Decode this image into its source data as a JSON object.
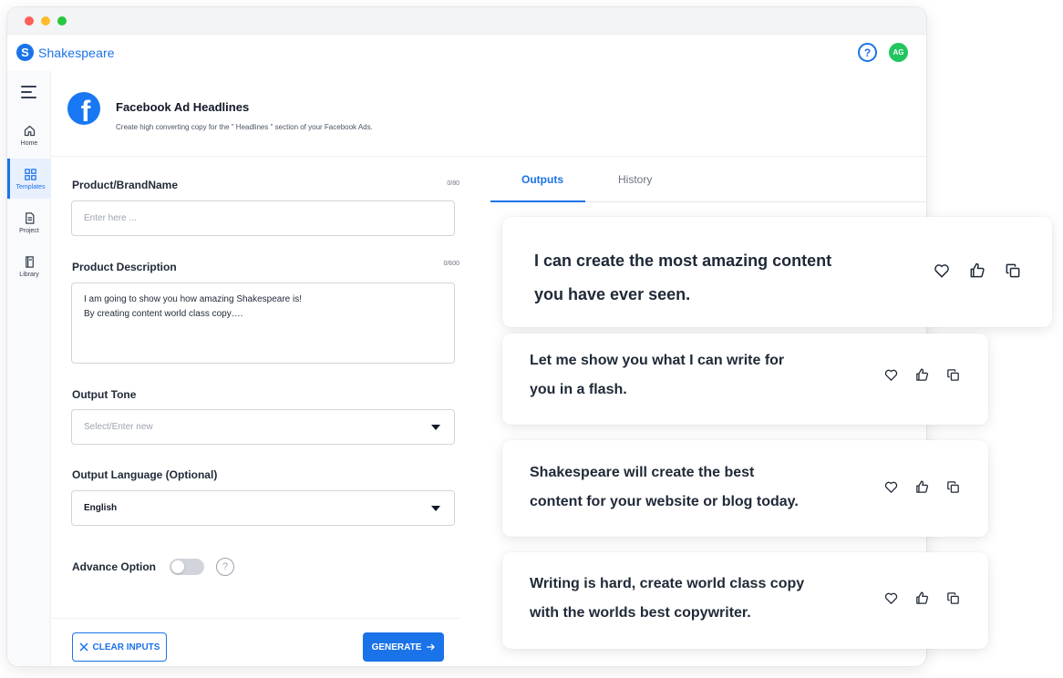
{
  "app": {
    "name": "Shakespeare",
    "logo_letter": "S",
    "help_label": "?",
    "avatar_initials": "AG"
  },
  "sidebar": {
    "items": [
      {
        "label": "Home",
        "icon": "home-icon"
      },
      {
        "label": "Templates",
        "icon": "grid-icon",
        "active": true
      },
      {
        "label": "Project",
        "icon": "document-icon"
      },
      {
        "label": "Library",
        "icon": "book-icon"
      }
    ]
  },
  "header": {
    "icon_letter": "f",
    "title": "Facebook Ad Headlines",
    "subtitle": "Create high converting copy for the \" Headlines \" section of your Facebook Ads."
  },
  "form": {
    "product_name": {
      "label": "Product/BrandName",
      "counter": "0/80",
      "placeholder": "Enter here ...",
      "value": ""
    },
    "product_description": {
      "label": "Product Description",
      "counter": "0/600",
      "value": "I am going to show you how amazing Shakespeare is!\nBy creating content world class copy…."
    },
    "output_tone": {
      "label": "Output Tone",
      "placeholder": "Select/Enter new"
    },
    "output_language": {
      "label": "Output  Language (Optional)",
      "value": "English"
    },
    "advance_option": {
      "label": "Advance Option",
      "enabled": false,
      "help_label": "?"
    },
    "clear_button": "CLEAR INPUTS",
    "generate_button": "GENERATE"
  },
  "output_panel": {
    "tabs": [
      {
        "label": "Outputs",
        "active": true
      },
      {
        "label": "History",
        "active": false
      }
    ],
    "results": [
      {
        "line1": "I can create the most amazing content",
        "line2": "you have ever seen."
      },
      {
        "line1": "Let me show you what I can write for",
        "line2": "you in a flash."
      },
      {
        "line1": "Shakespeare will create the best",
        "line2": "content for your website or blog today."
      },
      {
        "line1": "Writing is hard, create world class copy",
        "line2": "with the worlds best copywriter."
      }
    ]
  },
  "colors": {
    "accent": "#1a73e8",
    "facebook": "#1877f2",
    "avatar": "#22c55e"
  }
}
